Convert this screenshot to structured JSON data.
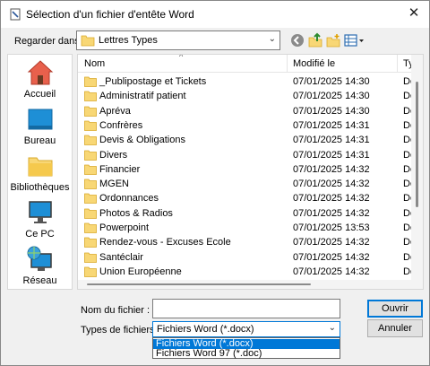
{
  "window": {
    "title": "Sélection d'un fichier d'entête Word",
    "close_glyph": "✕"
  },
  "lookin": {
    "label": "Regarder dans :",
    "value": "Lettres Types"
  },
  "toolbar": {
    "icons": [
      "back-icon",
      "up-folder-icon",
      "new-folder-icon",
      "view-menu-icon"
    ]
  },
  "places": [
    {
      "label": "Accueil",
      "icon": "home-icon"
    },
    {
      "label": "Bureau",
      "icon": "desktop-icon"
    },
    {
      "label": "Bibliothèques",
      "icon": "libraries-icon"
    },
    {
      "label": "Ce PC",
      "icon": "computer-icon"
    },
    {
      "label": "Réseau",
      "icon": "network-icon"
    }
  ],
  "columns": {
    "name": "Nom",
    "modified": "Modifié le",
    "type": "Ty"
  },
  "files": [
    {
      "name": "_Publipostage et Tickets",
      "date": "07/01/2025 14:30",
      "type": "Dossier"
    },
    {
      "name": "Administratif patient",
      "date": "07/01/2025 14:30",
      "type": "Dossier"
    },
    {
      "name": "Apréva",
      "date": "07/01/2025 14:30",
      "type": "Dossier"
    },
    {
      "name": "Confrères",
      "date": "07/01/2025 14:31",
      "type": "Dossier"
    },
    {
      "name": "Devis & Obligations",
      "date": "07/01/2025 14:31",
      "type": "Dossier"
    },
    {
      "name": "Divers",
      "date": "07/01/2025 14:31",
      "type": "Dossier"
    },
    {
      "name": "Financier",
      "date": "07/01/2025 14:32",
      "type": "Dossier"
    },
    {
      "name": "MGEN",
      "date": "07/01/2025 14:32",
      "type": "Dossier"
    },
    {
      "name": "Ordonnances",
      "date": "07/01/2025 14:32",
      "type": "Dossier"
    },
    {
      "name": "Photos & Radios",
      "date": "07/01/2025 14:32",
      "type": "Dossier"
    },
    {
      "name": "Powerpoint",
      "date": "07/01/2025 13:53",
      "type": "Dossier"
    },
    {
      "name": "Rendez-vous - Excuses Ecole",
      "date": "07/01/2025 14:32",
      "type": "Dossier"
    },
    {
      "name": "Santéclair",
      "date": "07/01/2025 14:32",
      "type": "Dossier"
    },
    {
      "name": "Union Européenne",
      "date": "07/01/2025 14:32",
      "type": "Dossier"
    }
  ],
  "filename": {
    "label": "Nom du fichier :",
    "value": ""
  },
  "filetype": {
    "label": "Types de fichiers :",
    "value": "Fichiers Word  (*.docx)",
    "options": [
      "Fichiers Word  (*.docx)",
      "Fichiers Word 97 (*.doc)"
    ]
  },
  "buttons": {
    "open": "Ouvrir",
    "cancel": "Annuler"
  },
  "colors": {
    "accent": "#0078d7",
    "folder": "#f8d775"
  }
}
